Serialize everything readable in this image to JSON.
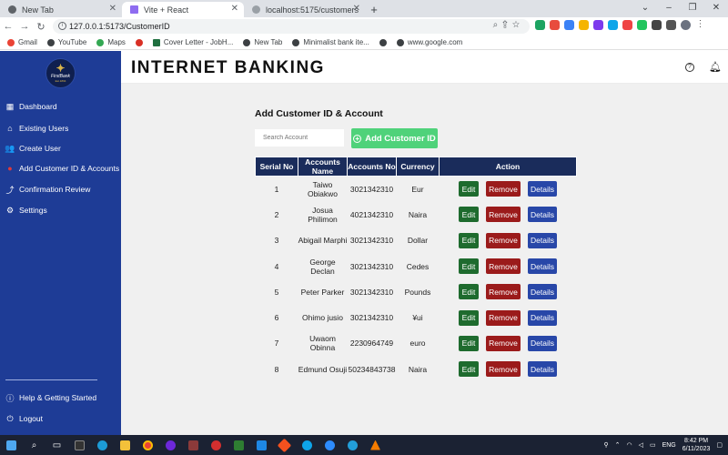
{
  "browser": {
    "tabs": [
      {
        "title": "New Tab",
        "active": false
      },
      {
        "title": "Vite + React",
        "active": true
      },
      {
        "title": "localhost:5175/customers",
        "active": false
      }
    ],
    "url": "127.0.0.1:5173/CustomerID",
    "bookmarks": [
      "Gmail",
      "YouTube",
      "Maps",
      "",
      "Cover Letter - JobH...",
      "New Tab",
      "Minimalist bank ite...",
      "",
      "www.google.com"
    ]
  },
  "logo": {
    "name": "FirstBank",
    "sub": "Est.1894"
  },
  "sidebar": {
    "items": [
      {
        "label": "Dashboard",
        "icon": "grid-icon"
      },
      {
        "label": "Existing Users",
        "icon": "bank-icon"
      },
      {
        "label": "Create User",
        "icon": "users-icon"
      },
      {
        "label": "Add Customer ID & Accounts",
        "icon": "user-add-icon"
      },
      {
        "label": "Confirmation Review",
        "icon": "chart-icon"
      },
      {
        "label": "Settings",
        "icon": "gear-icon"
      }
    ],
    "bottom": [
      {
        "label": "Help & Getting Started",
        "icon": "help-icon"
      },
      {
        "label": "Logout",
        "icon": "logout-icon"
      }
    ]
  },
  "header": {
    "title": "INTERNET BANKING"
  },
  "page": {
    "section_title": "Add Customer ID & Account",
    "search_placeholder": "Search Account",
    "add_button": "Add Customer ID"
  },
  "table": {
    "columns": [
      "Serial No",
      "Accounts Name",
      "Accounts No",
      "Currency",
      "Action"
    ],
    "actions": {
      "edit": "Edit",
      "remove": "Remove",
      "details": "Details"
    },
    "rows": [
      {
        "serial": "1",
        "name": "Taiwo Obiakwo",
        "account": "3021342310",
        "currency": "Eur"
      },
      {
        "serial": "2",
        "name": "Josua Philimon",
        "account": "4021342310",
        "currency": "Naira"
      },
      {
        "serial": "3",
        "name": "Abigail Marphi",
        "account": "3021342310",
        "currency": "Dollar"
      },
      {
        "serial": "4",
        "name": "George Declan",
        "account": "3021342310",
        "currency": "Cedes"
      },
      {
        "serial": "5",
        "name": "Peter Parker",
        "account": "3021342310",
        "currency": "Pounds"
      },
      {
        "serial": "6",
        "name": "Ohimo jusio",
        "account": "3021342310",
        "currency": "¥ui"
      },
      {
        "serial": "7",
        "name": "Uwaom Obinna",
        "account": "2230964749",
        "currency": "euro"
      },
      {
        "serial": "8",
        "name": "Edmund Osuji",
        "account": "50234843738",
        "currency": "Naira"
      }
    ]
  },
  "taskbar": {
    "lang": "ENG",
    "time": "8:42 PM",
    "date": "6/11/2023"
  },
  "colors": {
    "sidebar": "#1e3c96",
    "table_header": "#1a2c5b",
    "add_button": "#4fd27a",
    "edit": "#1e6b2e",
    "remove": "#9b1b1b",
    "details": "#2847a8"
  }
}
